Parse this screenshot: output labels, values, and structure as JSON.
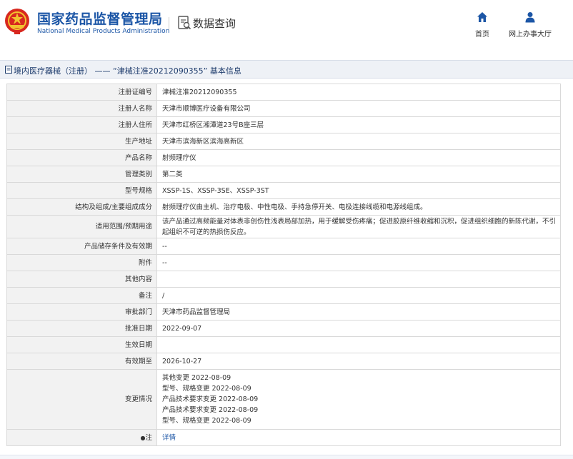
{
  "header": {
    "site_name_cn": "国家药品监督管理局",
    "site_name_en": "National Medical Products Administration",
    "query_title": "数据查询",
    "nav": [
      {
        "label": "首页",
        "icon": "home-icon"
      },
      {
        "label": "网上办事大厅",
        "icon": "user-icon"
      }
    ]
  },
  "breadcrumb": {
    "category": "境内医疗器械（注册）",
    "separator": " —— ",
    "record": "“津械注准20212090355”",
    "suffix": " 基本信息"
  },
  "details": {
    "registration_no": {
      "label": "注册证编号",
      "value": "津械注准20212090355"
    },
    "registrant_name": {
      "label": "注册人名称",
      "value": "天津市顺博医疗设备有限公司"
    },
    "registrant_address": {
      "label": "注册人住所",
      "value": "天津市红桥区湘潭道23号B座三层"
    },
    "production_address": {
      "label": "生产地址",
      "value": "天津市滨海新区滨海高新区"
    },
    "product_name": {
      "label": "产品名称",
      "value": "射频理疗仪"
    },
    "management_class": {
      "label": "管理类别",
      "value": "第二类"
    },
    "model_spec": {
      "label": "型号规格",
      "value": "XSSP-1S、XSSP-3SE、XSSP-3ST"
    },
    "structure": {
      "label": "结构及组成/主要组成成分",
      "value": "射频理疗仪由主机、治疗电极、中性电极、手持急停开关、电极连接线缆和电源线组成。"
    },
    "scope": {
      "label": "适用范围/预期用途",
      "value": "该产品通过高频能量对体表非创伤性浅表局部加热，用于缓解受伤疼痛；促进胶原纤维收缩和沉积，促进组织细胞的新陈代谢，不引起组织不可逆的热损伤反应。"
    },
    "storage": {
      "label": "产品储存条件及有效期",
      "value": "--"
    },
    "attachment": {
      "label": "附件",
      "value": "--"
    },
    "other": {
      "label": "其他内容",
      "value": ""
    },
    "remark": {
      "label": "备注",
      "value": "/"
    },
    "approval_dept": {
      "label": "审批部门",
      "value": "天津市药品监督管理局"
    },
    "approval_date": {
      "label": "批准日期",
      "value": "2022-09-07"
    },
    "effective_date": {
      "label": "生效日期",
      "value": ""
    },
    "valid_until": {
      "label": "有效期至",
      "value": "2026-10-27"
    },
    "changes": {
      "label": "变更情况",
      "items": [
        "其他变更 2022-08-09",
        "型号、规格变更 2022-08-09",
        "产品技术要求变更 2022-08-09",
        "产品技术要求变更 2022-08-09",
        "型号、规格变更 2022-08-09"
      ]
    },
    "note": {
      "label": "注",
      "link": "详情"
    }
  }
}
